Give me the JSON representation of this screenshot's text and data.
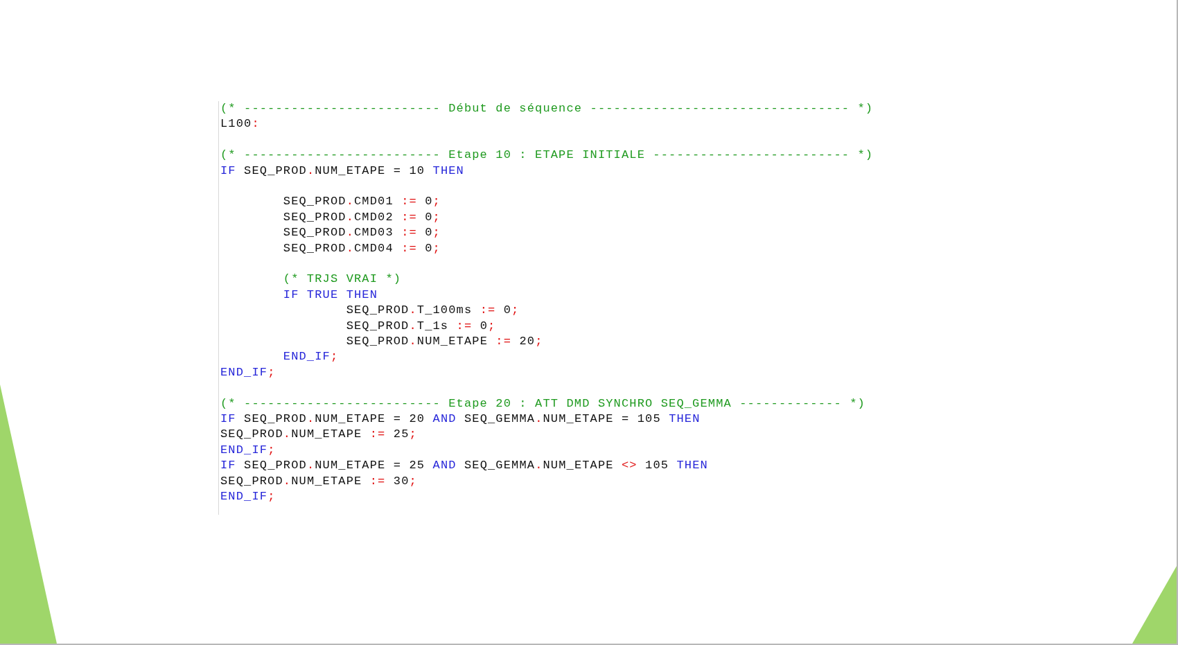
{
  "code_blocks": [
    [
      {
        "tokens": [
          {
            "text": "(* ------------------------- Début de séquence --------------------------------- *)",
            "kind": "comment"
          }
        ]
      },
      {
        "tokens": [
          {
            "text": "L100",
            "kind": "identifier"
          },
          {
            "text": ":",
            "kind": "operator"
          }
        ]
      }
    ],
    [
      {
        "tokens": [
          {
            "text": "(* ------------------------- Etape 10 : ETAPE INITIALE ------------------------- *)",
            "kind": "comment"
          }
        ]
      },
      {
        "tokens": [
          {
            "text": "IF",
            "kind": "keyword"
          },
          {
            "text": " SEQ_PROD",
            "kind": "identifier"
          },
          {
            "text": ".",
            "kind": "operator"
          },
          {
            "text": "NUM_ETAPE = 10 ",
            "kind": "identifier"
          },
          {
            "text": "THEN",
            "kind": "keyword"
          }
        ]
      }
    ],
    [
      {
        "tokens": [
          {
            "text": "        SEQ_PROD",
            "kind": "identifier"
          },
          {
            "text": ".",
            "kind": "operator"
          },
          {
            "text": "CMD01 ",
            "kind": "identifier"
          },
          {
            "text": ":=",
            "kind": "operator"
          },
          {
            "text": " 0",
            "kind": "identifier"
          },
          {
            "text": ";",
            "kind": "operator"
          }
        ]
      },
      {
        "tokens": [
          {
            "text": "        SEQ_PROD",
            "kind": "identifier"
          },
          {
            "text": ".",
            "kind": "operator"
          },
          {
            "text": "CMD02 ",
            "kind": "identifier"
          },
          {
            "text": ":=",
            "kind": "operator"
          },
          {
            "text": " 0",
            "kind": "identifier"
          },
          {
            "text": ";",
            "kind": "operator"
          }
        ]
      },
      {
        "tokens": [
          {
            "text": "        SEQ_PROD",
            "kind": "identifier"
          },
          {
            "text": ".",
            "kind": "operator"
          },
          {
            "text": "CMD03 ",
            "kind": "identifier"
          },
          {
            "text": ":=",
            "kind": "operator"
          },
          {
            "text": " 0",
            "kind": "identifier"
          },
          {
            "text": ";",
            "kind": "operator"
          }
        ]
      },
      {
        "tokens": [
          {
            "text": "        SEQ_PROD",
            "kind": "identifier"
          },
          {
            "text": ".",
            "kind": "operator"
          },
          {
            "text": "CMD04 ",
            "kind": "identifier"
          },
          {
            "text": ":=",
            "kind": "operator"
          },
          {
            "text": " 0",
            "kind": "identifier"
          },
          {
            "text": ";",
            "kind": "operator"
          }
        ]
      }
    ],
    [
      {
        "tokens": [
          {
            "text": "        (* TRJS VRAI *)",
            "kind": "comment"
          }
        ]
      },
      {
        "tokens": [
          {
            "text": "        IF TRUE THEN",
            "kind": "keyword"
          }
        ]
      },
      {
        "tokens": [
          {
            "text": "                SEQ_PROD",
            "kind": "identifier"
          },
          {
            "text": ".",
            "kind": "operator"
          },
          {
            "text": "T_100ms ",
            "kind": "identifier"
          },
          {
            "text": ":=",
            "kind": "operator"
          },
          {
            "text": " 0",
            "kind": "identifier"
          },
          {
            "text": ";",
            "kind": "operator"
          }
        ]
      },
      {
        "tokens": [
          {
            "text": "                SEQ_PROD",
            "kind": "identifier"
          },
          {
            "text": ".",
            "kind": "operator"
          },
          {
            "text": "T_1s ",
            "kind": "identifier"
          },
          {
            "text": ":=",
            "kind": "operator"
          },
          {
            "text": " 0",
            "kind": "identifier"
          },
          {
            "text": ";",
            "kind": "operator"
          }
        ]
      },
      {
        "tokens": [
          {
            "text": "                SEQ_PROD",
            "kind": "identifier"
          },
          {
            "text": ".",
            "kind": "operator"
          },
          {
            "text": "NUM_ETAPE ",
            "kind": "identifier"
          },
          {
            "text": ":=",
            "kind": "operator"
          },
          {
            "text": " 20",
            "kind": "identifier"
          },
          {
            "text": ";",
            "kind": "operator"
          }
        ]
      },
      {
        "tokens": [
          {
            "text": "        END_IF",
            "kind": "keyword"
          },
          {
            "text": ";",
            "kind": "operator"
          }
        ]
      },
      {
        "tokens": [
          {
            "text": "END_IF",
            "kind": "keyword"
          },
          {
            "text": ";",
            "kind": "operator"
          }
        ]
      }
    ],
    [
      {
        "tokens": [
          {
            "text": "(* ------------------------- Etape 20 : ATT DMD SYNCHRO SEQ_GEMMA ------------- *)",
            "kind": "comment"
          }
        ]
      },
      {
        "tokens": [
          {
            "text": "IF",
            "kind": "keyword"
          },
          {
            "text": " SEQ_PROD",
            "kind": "identifier"
          },
          {
            "text": ".",
            "kind": "operator"
          },
          {
            "text": "NUM_ETAPE = 20 ",
            "kind": "identifier"
          },
          {
            "text": "AND",
            "kind": "keyword"
          },
          {
            "text": " SEQ_GEMMA",
            "kind": "identifier"
          },
          {
            "text": ".",
            "kind": "operator"
          },
          {
            "text": "NUM_ETAPE = 105 ",
            "kind": "identifier"
          },
          {
            "text": "THEN",
            "kind": "keyword"
          }
        ]
      },
      {
        "tokens": [
          {
            "text": "SEQ_PROD",
            "kind": "identifier"
          },
          {
            "text": ".",
            "kind": "operator"
          },
          {
            "text": "NUM_ETAPE ",
            "kind": "identifier"
          },
          {
            "text": ":=",
            "kind": "operator"
          },
          {
            "text": " 25",
            "kind": "identifier"
          },
          {
            "text": ";",
            "kind": "operator"
          }
        ]
      },
      {
        "tokens": [
          {
            "text": "END_IF",
            "kind": "keyword"
          },
          {
            "text": ";",
            "kind": "operator"
          }
        ]
      },
      {
        "tokens": [
          {
            "text": "IF",
            "kind": "keyword"
          },
          {
            "text": " SEQ_PROD",
            "kind": "identifier"
          },
          {
            "text": ".",
            "kind": "operator"
          },
          {
            "text": "NUM_ETAPE = 25 ",
            "kind": "identifier"
          },
          {
            "text": "AND",
            "kind": "keyword"
          },
          {
            "text": " SEQ_GEMMA",
            "kind": "identifier"
          },
          {
            "text": ".",
            "kind": "operator"
          },
          {
            "text": "NUM_ETAPE ",
            "kind": "identifier"
          },
          {
            "text": "<>",
            "kind": "operator"
          },
          {
            "text": " 105 ",
            "kind": "identifier"
          },
          {
            "text": "THEN",
            "kind": "keyword"
          }
        ]
      },
      {
        "tokens": [
          {
            "text": "SEQ_PROD",
            "kind": "identifier"
          },
          {
            "text": ".",
            "kind": "operator"
          },
          {
            "text": "NUM_ETAPE ",
            "kind": "identifier"
          },
          {
            "text": ":=",
            "kind": "operator"
          },
          {
            "text": " 30",
            "kind": "identifier"
          },
          {
            "text": ";",
            "kind": "operator"
          }
        ]
      },
      {
        "tokens": [
          {
            "text": "END_IF",
            "kind": "keyword"
          },
          {
            "text": ";",
            "kind": "operator"
          }
        ]
      }
    ]
  ]
}
